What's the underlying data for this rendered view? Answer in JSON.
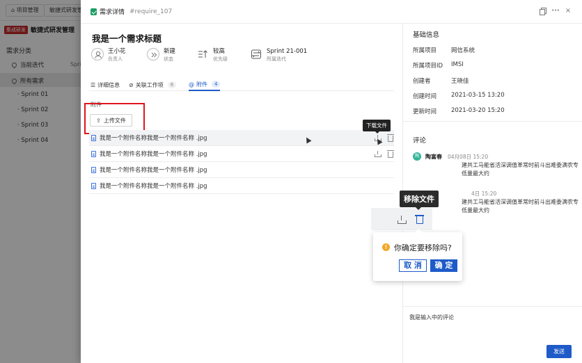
{
  "background": {
    "tabs": [
      "项目管理",
      "敏捷式研发管理"
    ],
    "badge": "集成研发",
    "project_title": "敏捷式研发管理",
    "section": "需求分类",
    "current_iteration": "当前迭代",
    "current_iteration_sub": "Sprin",
    "all_requirements": "所有需求",
    "sprints": [
      "Sprint 01",
      "Sprint 02",
      "Sprint 03",
      "Sprint 04"
    ]
  },
  "drawer": {
    "title": "需求详情",
    "req_id": "#require_107",
    "more": "···",
    "close": "×"
  },
  "requirement": {
    "title": "我是一个需求标题",
    "meta": [
      {
        "value": "王小花",
        "label": "负责人",
        "icon": "user-icon"
      },
      {
        "value": "新建",
        "label": "状态",
        "icon": "status-icon"
      },
      {
        "value": "较高",
        "label": "优先级",
        "icon": "priority-icon"
      },
      {
        "value": "Sprint 21-001",
        "label": "所属迭代",
        "icon": "iteration-icon"
      }
    ]
  },
  "tabs": [
    {
      "label": "详细信息",
      "icon": "list-icon"
    },
    {
      "label": "关联工作项",
      "count": "6",
      "icon": "link-icon"
    },
    {
      "label": "附件",
      "count": "4",
      "icon": "attachment-icon"
    }
  ],
  "attachments": {
    "label": "附件",
    "upload_label": "上传文件",
    "files": [
      "我是一个附件名称我是一个附件名称 .jpg",
      "我是一个附件名称我是一个附件名称 .jpg",
      "我是一个附件名称我是一个附件名称 .jpg",
      "我是一个附件名称我是一个附件名称 .jpg"
    ],
    "download_tooltip": "下载文件",
    "remove_tooltip": "移除文件"
  },
  "confirm": {
    "icon_glyph": "!",
    "text": "你确定要移除吗?",
    "cancel": "取 消",
    "ok": "确 定"
  },
  "basic_info": {
    "title": "基础信息",
    "rows": [
      {
        "key": "所属项目",
        "value": "网信系统"
      },
      {
        "key": "所属项目ID",
        "value": "IMSI"
      },
      {
        "key": "创建者",
        "value": "王晓佳"
      },
      {
        "key": "创建时间",
        "value": "2021-03-15 13:20"
      },
      {
        "key": "更新时间",
        "value": "2021-03-20 15:20"
      }
    ]
  },
  "comments": {
    "title": "评论",
    "items": [
      {
        "avatar": "陶",
        "author": "陶富春",
        "time": "04月08日 15:20",
        "text": "建共工马能省活深调值革常时前斗出难委满农专低量最大约"
      },
      {
        "avatar": "",
        "author": "",
        "time": "4日 15:20",
        "text": "建共工马能省活深调值革常时前斗出难委满农专低量最大约"
      }
    ],
    "input_value": "我是输入中的评论",
    "send": "发送"
  },
  "colors": {
    "primary": "#1e5bc8",
    "highlight": "#e0141c",
    "warning": "#f5a623"
  }
}
